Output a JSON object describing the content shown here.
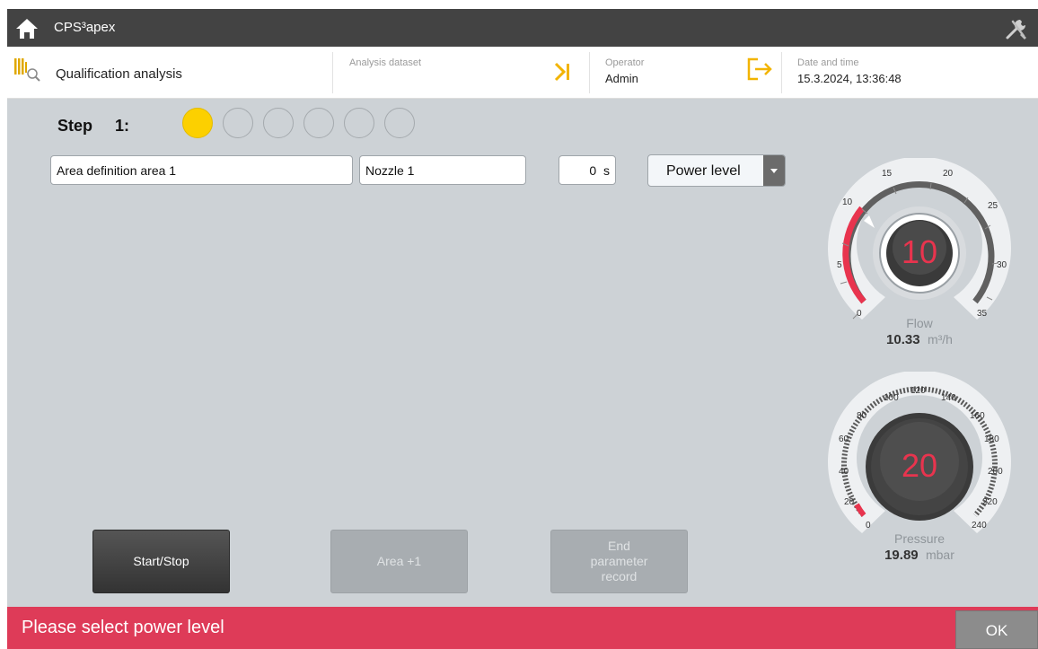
{
  "app": {
    "title": "CPS³apex"
  },
  "header": {
    "section_title": "Qualification analysis",
    "analysis_dataset_label": "Analysis dataset",
    "operator_label": "Operator",
    "operator_value": "Admin",
    "datetime_label": "Date and time",
    "datetime_value": "15.3.2024, 13:36:48"
  },
  "step": {
    "label": "Step",
    "number": "1:",
    "total": 6,
    "current": 1
  },
  "form": {
    "area_definition": "Area definition area 1",
    "nozzle": "Nozzle 1",
    "time_value": "0",
    "time_unit": "s",
    "dropdown_selected": "Power level"
  },
  "gauges": {
    "flow": {
      "name": "Flow",
      "current_display": "10",
      "value": "10.33",
      "unit": "m³/h",
      "ticks": [
        "0",
        "5",
        "10",
        "15",
        "20",
        "25",
        "30",
        "35"
      ]
    },
    "pressure": {
      "name": "Pressure",
      "current_display": "20",
      "value": "19.89",
      "unit": "mbar",
      "ticks": [
        "0",
        "20",
        "40",
        "60",
        "80",
        "100",
        "120",
        "140",
        "160",
        "180",
        "200",
        "220",
        "240"
      ]
    }
  },
  "buttons": {
    "start_stop": "Start/Stop",
    "area_plus": "Area +1",
    "end_line1": "End",
    "end_line2": "parameter",
    "end_line3": "record"
  },
  "status": {
    "message": "Please select power level",
    "ok_label": "OK"
  },
  "colors": {
    "titlebar": "#434343",
    "accent_yellow": "#fcd000",
    "status_red": "#de3b58",
    "gauge_red": "#e8344e",
    "content_bg": "#cdd2d6"
  }
}
